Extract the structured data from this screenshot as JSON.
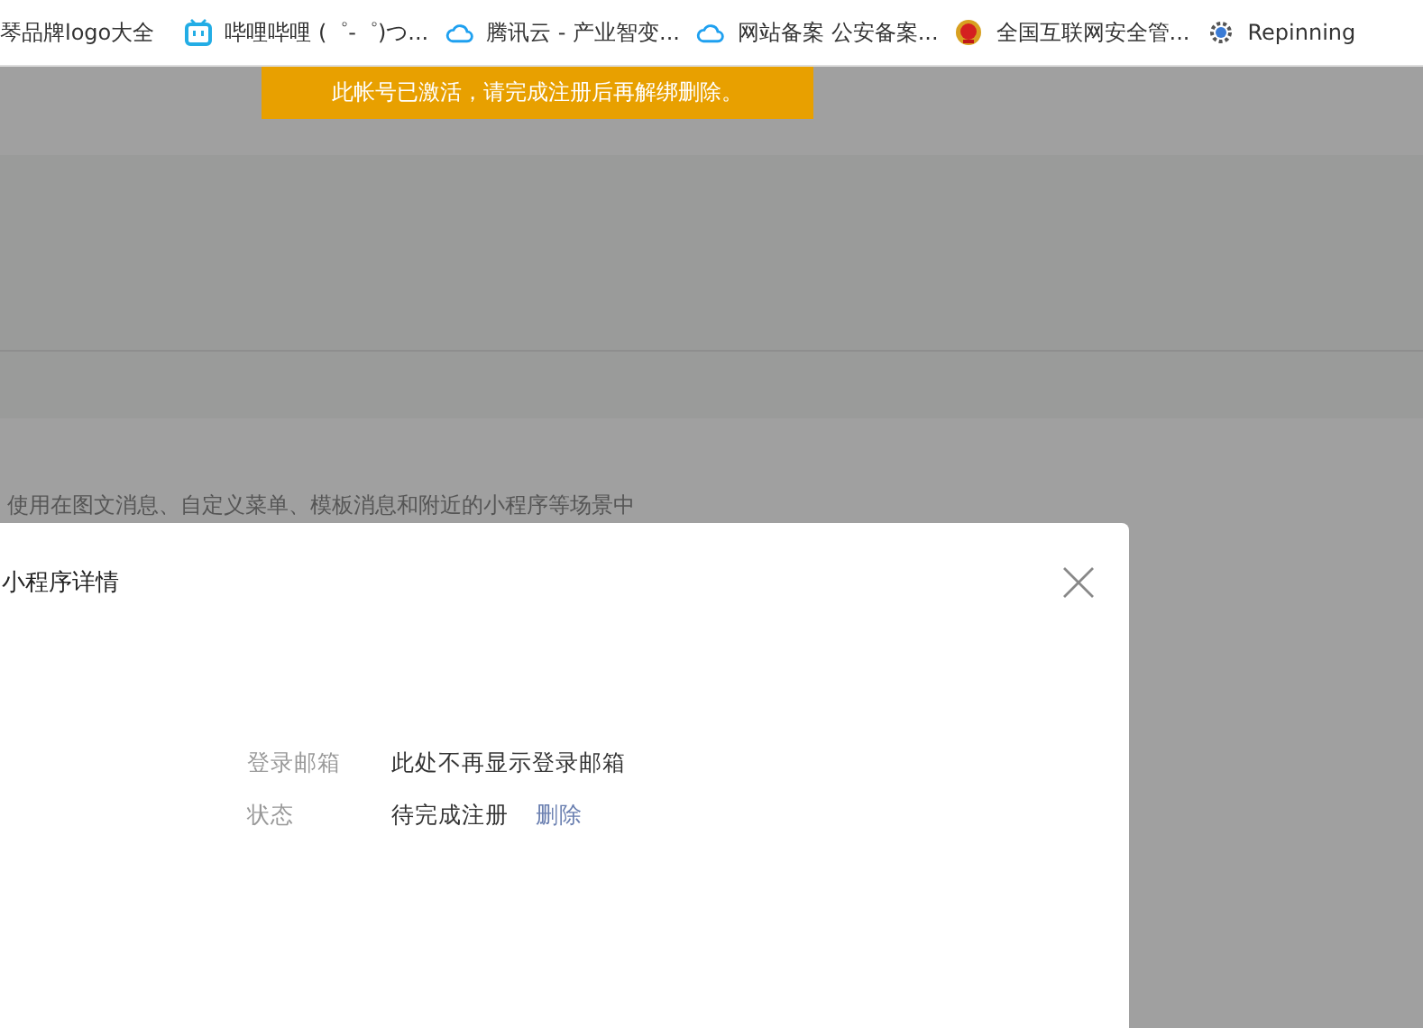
{
  "bookmarks": [
    {
      "label": "琴品牌logo大全",
      "kind": "plain"
    },
    {
      "label": "哔哩哔哩 (゜-゜)つ...",
      "kind": "tv"
    },
    {
      "label": "腾讯云 - 产业智变...",
      "kind": "cloud"
    },
    {
      "label": "网站备案 公安备案...",
      "kind": "cloud"
    },
    {
      "label": "全国互联网安全管...",
      "kind": "emblem"
    },
    {
      "label": "Repinning",
      "kind": "gear"
    }
  ],
  "notice": "此帐号已激活，请完成注册后再解绑删除。",
  "background_text": "使用在图文消息、自定义菜单、模板消息和附近的小程序等场景中",
  "dialog": {
    "title": "小程序详情",
    "rows": [
      {
        "label": "登录邮箱",
        "value": "此处不再显示登录邮箱"
      },
      {
        "label": "状态",
        "value": "待完成注册",
        "link": "删除"
      }
    ]
  }
}
